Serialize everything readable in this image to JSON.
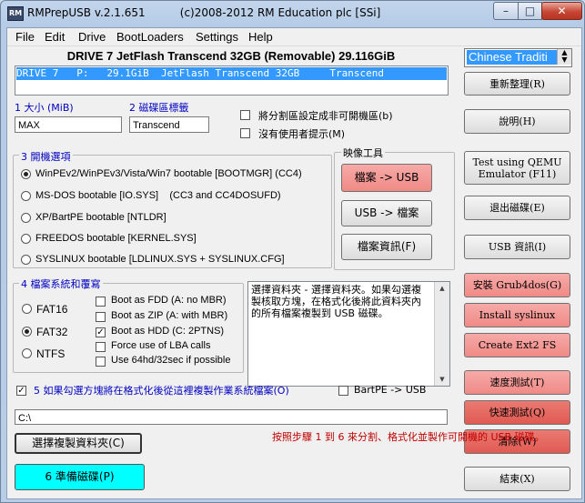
{
  "window": {
    "title": "RMPrepUSB v.2.1.651",
    "copyright": "(c)2008-2012 RM Education plc [SSi]",
    "icon_text": "RM"
  },
  "menu": [
    "File",
    "Edit",
    "Drive",
    "BootLoaders",
    "Settings",
    "Help"
  ],
  "drive": {
    "header": "DRIVE 7  JetFlash Transcend 32GB  (Removable) 29.116GiB",
    "list_row": "DRIVE 7   P:   29.1GiB  JetFlash Transcend 32GB     Transcend"
  },
  "language": {
    "selected": "Chinese Traditi"
  },
  "fields": {
    "size_label": "1 大小 (MiB)",
    "size_value": "MAX",
    "volume_label": "2 磁碟區標籤",
    "volume_value": "Transcend"
  },
  "options": {
    "non_bootable": "將分割區設定成非可開機區(b)",
    "no_prompt": "沒有使用者提示(M)"
  },
  "boot_options": {
    "title": "3 開機選項",
    "items": [
      "WinPEv2/WinPEv3/Vista/Win7 bootable [BOOTMGR] (CC4)",
      "MS-DOS bootable [IO.SYS]    (CC3 and CC4DOSUFD)",
      "XP/BartPE bootable [NTLDR]",
      "FREEDOS bootable [KERNEL.SYS]",
      "SYSLINUX bootable [LDLINUX.SYS + SYSLINUX.CFG]"
    ],
    "selected_index": 0
  },
  "tools": {
    "title": "映像工具",
    "file_to_usb": "檔案 -> USB",
    "usb_to_file": "USB -> 檔案",
    "file_info": "檔案資訊(F)"
  },
  "filesystem": {
    "title": "4 檔案系統和覆寫",
    "types": [
      "FAT16",
      "FAT32",
      "NTFS"
    ],
    "selected_index": 1,
    "overrides": [
      {
        "label": "Boot as FDD (A: no MBR)",
        "checked": false
      },
      {
        "label": "Boot as ZIP (A: with MBR)",
        "checked": false
      },
      {
        "label": "Boot as HDD (C: 2PTNS)",
        "checked": true
      },
      {
        "label": "Force use of LBA calls",
        "checked": false
      },
      {
        "label": "Use 64hd/32sec if possible",
        "checked": false
      }
    ]
  },
  "notes": "選擇資料夾 - 選擇資料夾。如果勾選複製核取方塊，在格式化後將此資料夾內的所有檔案複製到 USB 磁碟。",
  "copy_option": "5 如果勾選方塊將在格式化後從這裡複製作業系統檔案(O)",
  "bartpe": "BartPE -> USB",
  "path_value": "C:\\",
  "select_folder_button": "選擇複製資料夾(C)",
  "prepare_button": "6 準備磁碟(P)",
  "instruction": "按照步驟 1 到 6 來分割、格式化並製作可開機的 USB 磁碟。",
  "right_buttons": {
    "refresh": "重新整理(R)",
    "help": "說明(H)",
    "qemu": "Test using QEMU Emulator (F11)",
    "eject": "退出磁碟(E)",
    "usb_info": "USB 資訊(I)",
    "grub4dos": "安裝 Grub4dos(G)",
    "syslinux": "Install syslinux",
    "ext2": "Create Ext2 FS",
    "speed_test": "速度測試(T)",
    "quick_test": "快速測試(Q)",
    "clean": "清除(W)",
    "exit": "結束(X)"
  },
  "colors": {
    "selection_blue": "#3399ff",
    "pink_button": "#f08a86",
    "red_button": "#e05a52",
    "cyan_button": "#00ffff",
    "instruction_red": "#c00000",
    "label_blue": "#0000c0"
  }
}
